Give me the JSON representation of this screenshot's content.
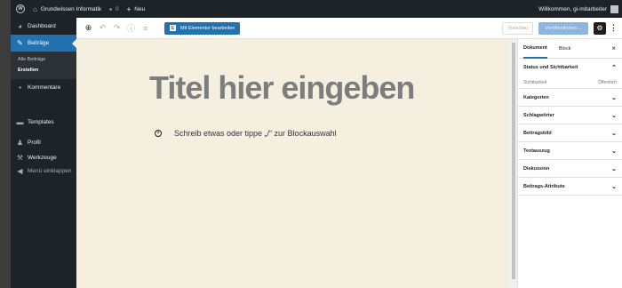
{
  "adminbar": {
    "site_name": "Grundwissen Informatik",
    "comments_count": "0",
    "new_label": "Neu",
    "greeting": "Willkommen, gi-mitarbeiter"
  },
  "sidebar": {
    "dashboard": "Dashboard",
    "posts": "Beiträge",
    "submenu": [
      "Alle Beiträge",
      "Erstellen"
    ],
    "comments": "Kommentare",
    "templates": "Templates",
    "profile": "Profil",
    "tools": "Werkzeuge",
    "collapse": "Menü einklappen"
  },
  "toolbar": {
    "elementor_label": "Mit Elementor bearbeiten",
    "preview_label": "Vorschau",
    "publish_label": "Veröffentlichen…"
  },
  "canvas": {
    "title_placeholder": "Titel hier eingeben",
    "block_prompt": "Schreib etwas oder tippe „/“ zur Blockauswahl"
  },
  "panel": {
    "tabs": [
      "Dokument",
      "Block"
    ],
    "status_heading": "Status und Sichtbarkeit",
    "visibility_label": "Sichtbarkeit",
    "visibility_value": "Öffentlich",
    "sections": [
      "Kategorien",
      "Schlagwörter",
      "Beitragsbild",
      "Textauszug",
      "Diskussion",
      "Beitrags-Attribute"
    ]
  },
  "colors": {
    "admin_dark": "#1d2327",
    "accent": "#2271b1",
    "canvas_bg": "#f5efe0"
  }
}
